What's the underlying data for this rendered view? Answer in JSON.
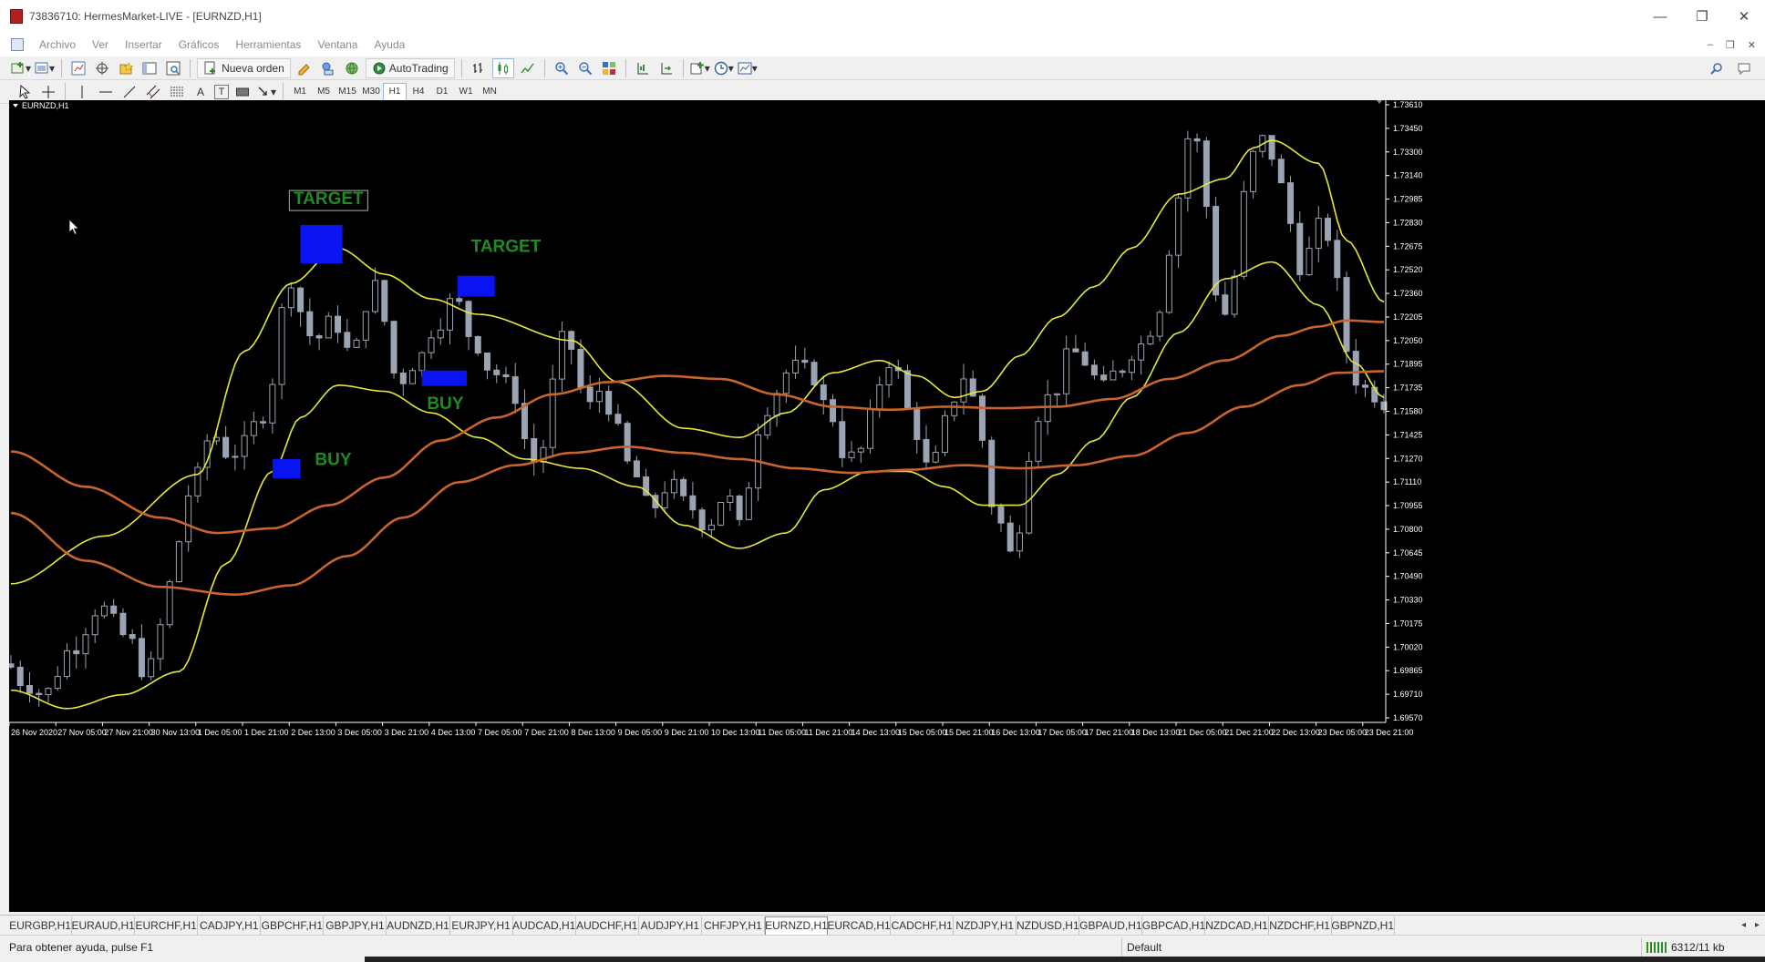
{
  "window": {
    "title": "73836710: HermesMarket-LIVE - [EURNZD,H1]",
    "controls": {
      "minimize": "—",
      "restore": "❐",
      "close": "✕"
    }
  },
  "menu": {
    "items": [
      "Archivo",
      "Ver",
      "Insertar",
      "Gráficos",
      "Herramientas",
      "Ventana",
      "Ayuda"
    ],
    "mdi": {
      "minimize": "–",
      "restore": "❐",
      "close": "✕"
    }
  },
  "toolbar": {
    "new_order": "Nueva orden",
    "autotrading": "AutoTrading",
    "text_tool": "A",
    "text_label_tool": "T"
  },
  "timeframes": {
    "items": [
      "M1",
      "M5",
      "M15",
      "M30",
      "H1",
      "H4",
      "D1",
      "W1",
      "MN"
    ],
    "active": "H1"
  },
  "colors": {
    "background": "#000000",
    "candle": "#9aa4b2",
    "yellow_band": "#e8e83a",
    "orange_band": "#c8642c",
    "signal_box": "#0a14f0",
    "signal_text": "#1e8c1e"
  },
  "chart_data": {
    "type": "candlestick",
    "symbol_label": "EURNZD,H1",
    "ylim": [
      1.6957,
      1.7361
    ],
    "yticks": [
      "1.73610",
      "1.73450",
      "1.73300",
      "1.73140",
      "1.72985",
      "1.72830",
      "1.72675",
      "1.72520",
      "1.72360",
      "1.72205",
      "1.72050",
      "1.71895",
      "1.71735",
      "1.71580",
      "1.71425",
      "1.71270",
      "1.71110",
      "1.70955",
      "1.70800",
      "1.70645",
      "1.70490",
      "1.70330",
      "1.70175",
      "1.70020",
      "1.69865",
      "1.69710",
      "1.69570"
    ],
    "xticks": [
      "26 Nov 2020",
      "27 Nov 05:00",
      "27 Nov 21:00",
      "30 Nov 13:00",
      "1 Dec 05:00",
      "1 Dec 21:00",
      "2 Dec 13:00",
      "3 Dec 05:00",
      "3 Dec 21:00",
      "4 Dec 13:00",
      "7 Dec 05:00",
      "7 Dec 21:00",
      "8 Dec 13:00",
      "9 Dec 05:00",
      "9 Dec 21:00",
      "10 Dec 13:00",
      "11 Dec 05:00",
      "11 Dec 21:00",
      "14 Dec 13:00",
      "15 Dec 05:00",
      "15 Dec 21:00",
      "16 Dec 13:00",
      "17 Dec 05:00",
      "17 Dec 21:00",
      "18 Dec 13:00",
      "21 Dec 05:00",
      "21 Dec 21:00",
      "22 Dec 13:00",
      "23 Dec 05:00",
      "23 Dec 21:00"
    ],
    "price_path": [
      [
        0,
        1.6995
      ],
      [
        2,
        1.6982
      ],
      [
        4,
        1.6975
      ],
      [
        7,
        1.7005
      ],
      [
        10,
        1.7032
      ],
      [
        13,
        1.7012
      ],
      [
        15,
        1.6988
      ],
      [
        17,
        1.7025
      ],
      [
        18,
        1.7068
      ],
      [
        20,
        1.7112
      ],
      [
        22,
        1.7145
      ],
      [
        24,
        1.713
      ],
      [
        25,
        1.7135
      ],
      [
        27,
        1.7152
      ],
      [
        29,
        1.7185
      ],
      [
        30,
        1.7262
      ],
      [
        31,
        1.7228
      ],
      [
        33,
        1.7205
      ],
      [
        35,
        1.7218
      ],
      [
        37,
        1.7195
      ],
      [
        39,
        1.7235
      ],
      [
        40,
        1.7245
      ],
      [
        41,
        1.719
      ],
      [
        42,
        1.7178
      ],
      [
        44,
        1.7192
      ],
      [
        46,
        1.7215
      ],
      [
        48,
        1.7232
      ],
      [
        50,
        1.7205
      ],
      [
        52,
        1.7185
      ],
      [
        54,
        1.7175
      ],
      [
        56,
        1.7135
      ],
      [
        57,
        1.7118
      ],
      [
        58,
        1.7155
      ],
      [
        59,
        1.7198
      ],
      [
        60,
        1.7212
      ],
      [
        61,
        1.7188
      ],
      [
        62,
        1.716
      ],
      [
        64,
        1.7175
      ],
      [
        65,
        1.715
      ],
      [
        67,
        1.712
      ],
      [
        69,
        1.7095
      ],
      [
        71,
        1.7112
      ],
      [
        73,
        1.7098
      ],
      [
        75,
        1.7085
      ],
      [
        77,
        1.7105
      ],
      [
        79,
        1.708
      ],
      [
        80,
        1.7145
      ],
      [
        82,
        1.7165
      ],
      [
        83,
        1.718
      ],
      [
        84,
        1.7188
      ],
      [
        86,
        1.7185
      ],
      [
        88,
        1.716
      ],
      [
        90,
        1.7128
      ],
      [
        92,
        1.7135
      ],
      [
        93,
        1.7175
      ],
      [
        95,
        1.7195
      ],
      [
        96,
        1.717
      ],
      [
        97,
        1.715
      ],
      [
        99,
        1.7118
      ],
      [
        100,
        1.7138
      ],
      [
        101,
        1.7165
      ],
      [
        103,
        1.7185
      ],
      [
        104,
        1.715
      ],
      [
        106,
        1.709
      ],
      [
        108,
        1.7062
      ],
      [
        109,
        1.711
      ],
      [
        110,
        1.7155
      ],
      [
        112,
        1.717
      ],
      [
        114,
        1.7198
      ],
      [
        116,
        1.719
      ],
      [
        117,
        1.7172
      ],
      [
        119,
        1.7185
      ],
      [
        121,
        1.72
      ],
      [
        123,
        1.7215
      ],
      [
        124,
        1.724
      ],
      [
        125,
        1.729
      ],
      [
        127,
        1.7345
      ],
      [
        128,
        1.732
      ],
      [
        129,
        1.7265
      ],
      [
        130,
        1.721
      ],
      [
        131,
        1.7235
      ],
      [
        133,
        1.731
      ],
      [
        134,
        1.734
      ],
      [
        135,
        1.733
      ],
      [
        137,
        1.73
      ],
      [
        138,
        1.7262
      ],
      [
        139,
        1.7245
      ],
      [
        140,
        1.728
      ],
      [
        142,
        1.7272
      ],
      [
        143,
        1.721
      ],
      [
        144,
        1.7188
      ],
      [
        145,
        1.7172
      ],
      [
        146,
        1.7175
      ],
      [
        147,
        1.7165
      ]
    ],
    "series": [
      {
        "kind": "yellow-upper",
        "points": [
          [
            0,
            1.7047
          ],
          [
            10,
            1.7078
          ],
          [
            20,
            1.7118
          ],
          [
            25,
            1.7198
          ],
          [
            30,
            1.7242
          ],
          [
            35,
            1.7265
          ],
          [
            40,
            1.7248
          ],
          [
            45,
            1.7232
          ],
          [
            50,
            1.7222
          ],
          [
            60,
            1.7205
          ],
          [
            65,
            1.7178
          ],
          [
            72,
            1.7148
          ],
          [
            78,
            1.7142
          ],
          [
            83,
            1.7158
          ],
          [
            88,
            1.7184
          ],
          [
            93,
            1.7192
          ],
          [
            97,
            1.7182
          ],
          [
            101,
            1.7168
          ],
          [
            104,
            1.7172
          ],
          [
            108,
            1.7195
          ],
          [
            112,
            1.722
          ],
          [
            116,
            1.724
          ],
          [
            120,
            1.7265
          ],
          [
            125,
            1.73
          ],
          [
            130,
            1.731
          ],
          [
            133,
            1.733
          ],
          [
            135,
            1.7335
          ],
          [
            140,
            1.732
          ],
          [
            143,
            1.727
          ],
          [
            147,
            1.723
          ]
        ]
      },
      {
        "kind": "yellow-lower",
        "points": [
          [
            0,
            1.6978
          ],
          [
            6,
            1.6966
          ],
          [
            12,
            1.6975
          ],
          [
            18,
            1.699
          ],
          [
            23,
            1.706
          ],
          [
            28,
            1.712
          ],
          [
            31,
            1.7155
          ],
          [
            35,
            1.7176
          ],
          [
            40,
            1.7172
          ],
          [
            45,
            1.7158
          ],
          [
            50,
            1.7142
          ],
          [
            55,
            1.7128
          ],
          [
            61,
            1.7122
          ],
          [
            67,
            1.711
          ],
          [
            72,
            1.7085
          ],
          [
            78,
            1.707
          ],
          [
            83,
            1.708
          ],
          [
            87,
            1.7108
          ],
          [
            92,
            1.712
          ],
          [
            96,
            1.712
          ],
          [
            100,
            1.711
          ],
          [
            104,
            1.7098
          ],
          [
            108,
            1.7098
          ],
          [
            112,
            1.7118
          ],
          [
            116,
            1.714
          ],
          [
            120,
            1.7168
          ],
          [
            125,
            1.721
          ],
          [
            130,
            1.7245
          ],
          [
            135,
            1.7256
          ],
          [
            140,
            1.7228
          ],
          [
            144,
            1.719
          ],
          [
            147,
            1.7168
          ]
        ]
      },
      {
        "kind": "orange-upper",
        "points": [
          [
            0,
            1.7133
          ],
          [
            8,
            1.711
          ],
          [
            16,
            1.709
          ],
          [
            22,
            1.708
          ],
          [
            28,
            1.7083
          ],
          [
            34,
            1.7098
          ],
          [
            40,
            1.7116
          ],
          [
            46,
            1.714
          ],
          [
            52,
            1.7155
          ],
          [
            58,
            1.717
          ],
          [
            64,
            1.7178
          ],
          [
            70,
            1.7182
          ],
          [
            76,
            1.718
          ],
          [
            82,
            1.717
          ],
          [
            88,
            1.7162
          ],
          [
            94,
            1.716
          ],
          [
            100,
            1.7162
          ],
          [
            106,
            1.7161
          ],
          [
            112,
            1.7162
          ],
          [
            118,
            1.7167
          ],
          [
            124,
            1.718
          ],
          [
            130,
            1.7192
          ],
          [
            136,
            1.7208
          ],
          [
            140,
            1.7214
          ],
          [
            143,
            1.7218
          ],
          [
            147,
            1.7217
          ]
        ]
      },
      {
        "kind": "orange-lower",
        "points": [
          [
            0,
            1.7093
          ],
          [
            8,
            1.7062
          ],
          [
            16,
            1.7045
          ],
          [
            24,
            1.704
          ],
          [
            30,
            1.7046
          ],
          [
            36,
            1.7065
          ],
          [
            42,
            1.709
          ],
          [
            48,
            1.7113
          ],
          [
            54,
            1.7124
          ],
          [
            60,
            1.7132
          ],
          [
            66,
            1.7136
          ],
          [
            72,
            1.7132
          ],
          [
            78,
            1.7128
          ],
          [
            84,
            1.7122
          ],
          [
            90,
            1.7119
          ],
          [
            96,
            1.7121
          ],
          [
            102,
            1.7124
          ],
          [
            108,
            1.7122
          ],
          [
            114,
            1.7124
          ],
          [
            120,
            1.713
          ],
          [
            126,
            1.7145
          ],
          [
            132,
            1.7162
          ],
          [
            138,
            1.7176
          ],
          [
            142,
            1.7184
          ],
          [
            147,
            1.7185
          ]
        ]
      }
    ],
    "annotations": [
      {
        "label": "TARGET",
        "kind": "target-framed",
        "box": {
          "x0": 31.0,
          "x1": 35.5,
          "y0": 1.7255,
          "y1": 1.728
        },
        "text_at": [
          34.0,
          1.72935
        ]
      },
      {
        "label": "BUY",
        "kind": "buy",
        "box": {
          "x0": 28.0,
          "x1": 31.0,
          "y0": 1.71155,
          "y1": 1.7128
        },
        "text_at": [
          34.5,
          1.7124
        ]
      },
      {
        "label": "BUY",
        "kind": "buy",
        "box": {
          "x0": 44.0,
          "x1": 48.8,
          "y0": 1.71755,
          "y1": 1.71855
        },
        "text_at": [
          46.5,
          1.71605
        ]
      },
      {
        "label": "TARGET",
        "kind": "target",
        "box": {
          "x0": 47.8,
          "x1": 51.8,
          "y0": 1.72335,
          "y1": 1.7247
        },
        "text_at": [
          53.0,
          1.72625
        ]
      }
    ]
  },
  "symbol_tabs": {
    "items": [
      "EURGBP,H1",
      "EURAUD,H1",
      "EURCHF,H1",
      "CADJPY,H1",
      "GBPCHF,H1",
      "GBPJPY,H1",
      "AUDNZD,H1",
      "EURJPY,H1",
      "AUDCAD,H1",
      "AUDCHF,H1",
      "AUDJPY,H1",
      "CHFJPY,H1",
      "EURNZD,H1",
      "EURCAD,H1",
      "CADCHF,H1",
      "NZDJPY,H1",
      "NZDUSD,H1",
      "GBPAUD,H1",
      "GBPCAD,H1",
      "NZDCAD,H1",
      "NZDCHF,H1",
      "GBPNZD,H1"
    ],
    "active": "EURNZD,H1",
    "prev": "◂",
    "next": "▸"
  },
  "status": {
    "help": "Para obtener ayuda, pulse F1",
    "profile": "Default",
    "traffic": "6312/11 kb"
  }
}
